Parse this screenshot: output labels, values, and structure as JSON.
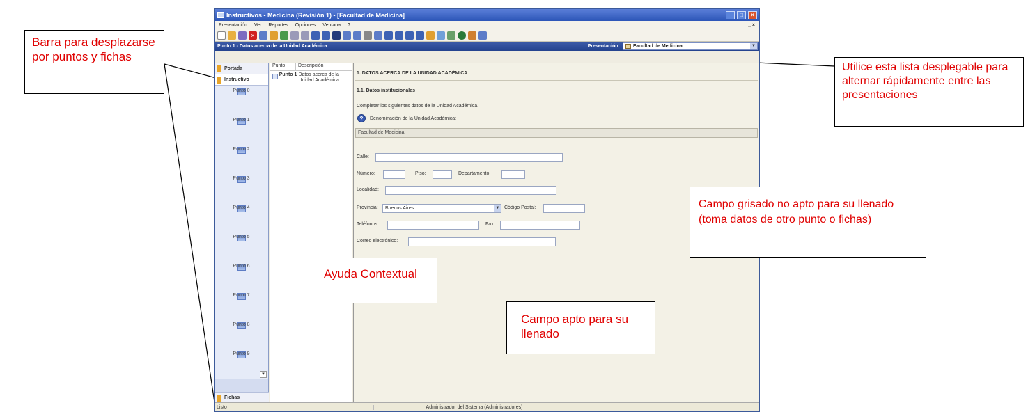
{
  "window": {
    "title": "Instructivos - Medicina (Revisión 1) - [Facultad de Medicina]",
    "menu": [
      "Presentación",
      "Ver",
      "Reportes",
      "Opciones",
      "Ventana",
      "?"
    ],
    "menu_right": "_ ×"
  },
  "section_bar": {
    "title": "Punto 1 - Datos acerca de la Unidad Académica",
    "presentation_label": "Presentación:",
    "presentation_value": "Facultad de Medicina"
  },
  "nav": {
    "portada": "Portada",
    "instructivo": "Instructivo",
    "items": [
      "Punto 0",
      "Punto 1",
      "Punto 2",
      "Punto 3",
      "Punto 4",
      "Punto 5",
      "Punto 6",
      "Punto 7",
      "Punto 8",
      "Punto 9"
    ],
    "fichas": "Fichas"
  },
  "list": {
    "col_punto": "Punto",
    "col_descripcion": "Descripción",
    "row_punto": "Punto 1",
    "row_desc": "Datos acerca de la Unidad Académica"
  },
  "form": {
    "heading1": "1. DATOS ACERCA DE LA UNIDAD ACADÉMICA",
    "heading2": "1.1. Datos institucionales",
    "intro": "Completar los siguientes datos de la Unidad Académica.",
    "denominacion_label": "Denominación de la Unidad Académica:",
    "denominacion_value": "Facultad de Medicina",
    "calle_label": "Calle:",
    "numero_label": "Número:",
    "piso_label": "Piso:",
    "departamento_label": "Departamento:",
    "localidad_label": "Localidad:",
    "provincia_label": "Provincia:",
    "provincia_value": "Buenos Aires",
    "cp_label": "Código Postal:",
    "telefonos_label": "Teléfonos:",
    "fax_label": "Fax:",
    "correo_label": "Correo electrónico:"
  },
  "status": {
    "left": "Listo",
    "center": "Administrador del Sistema (Administradores)"
  },
  "callouts": {
    "nav": "Barra para desplazarse por puntos y fichas",
    "list": "Utilice esta lista desplegable para alternar rápidamente entre las presentaciones",
    "grey": "Campo grisado no apto para su llenado (toma datos de otro punto o fichas)",
    "help": "Ayuda Contextual",
    "field": "Campo apto para su llenado"
  },
  "colors": {
    "callout_text": "#e00000",
    "titlebar": "#2d56b8"
  }
}
